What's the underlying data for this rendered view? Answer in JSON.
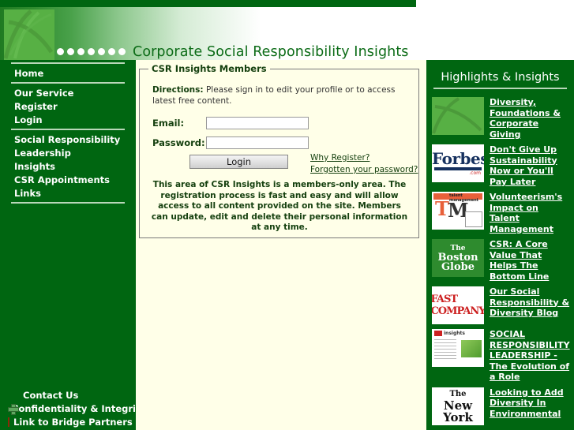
{
  "header": {
    "title": "Corporate Social Responsibility Insights",
    "dot_count": 7,
    "logo_name": "csr-insights-logo"
  },
  "colors": {
    "brand_green": "#006611",
    "header_green": "#0b6b16",
    "content_bg": "#ffffe8",
    "nav_text": "#ffffff",
    "link_green": "#15400f"
  },
  "sidebar": {
    "groups": [
      {
        "items": [
          {
            "label": "Home",
            "name": "sidebar-item-home"
          }
        ]
      },
      {
        "items": [
          {
            "label": "Our Service",
            "name": "sidebar-item-our-service"
          },
          {
            "label": "Register",
            "name": "sidebar-item-register"
          },
          {
            "label": "Login",
            "name": "sidebar-item-login"
          }
        ]
      },
      {
        "items": [
          {
            "label": "Social Responsibility",
            "name": "sidebar-item-social-responsibility"
          },
          {
            "label": "Leadership",
            "name": "sidebar-item-leadership"
          },
          {
            "label": "Insights",
            "name": "sidebar-item-insights"
          },
          {
            "label": "CSR Appointments",
            "name": "sidebar-item-csr-appointments"
          },
          {
            "label": "Links",
            "name": "sidebar-item-links"
          }
        ]
      }
    ],
    "footer_items": [
      {
        "label": "Contact Us",
        "icon": "none"
      },
      {
        "label": "Confidentiality & Integrity",
        "icon": "green-cross-icon"
      },
      {
        "label": "Link to Bridge Partners LLC",
        "icon": "orange-square-icon"
      }
    ]
  },
  "login_panel": {
    "legend": "CSR Insights Members",
    "directions_label": "Directions:",
    "directions_text": " Please sign in to edit your profile or to access latest free content.",
    "email_label": "Email:",
    "email_value": "",
    "email_placeholder": "",
    "password_label": "Password:",
    "password_value": "",
    "password_placeholder": "",
    "help_icon": "?",
    "login_button": "Login",
    "why_register_link": "Why Register?",
    "forgotten_password_link": "Forgotten your password?",
    "notice": "This area of CSR Insights is a members-only area. The registration process is fast and easy and will allow access to all content provided on the site. Members can update, edit and delete their personal information at any time."
  },
  "highlights": {
    "title": "Highlights & Insights",
    "items": [
      {
        "thumb": "csr-insights-logo-thumbnail",
        "text": "Diversity, Foundations & Corporate Giving"
      },
      {
        "thumb": "forbes-logo-thumbnail",
        "text": "Don't Give Up Sustainability Now or You'll Pay Later"
      },
      {
        "thumb": "talent-management-logo-thumbnail",
        "text": "Volunteerism's Impact on Talent Management"
      },
      {
        "thumb": "boston-globe-logo-thumbnail",
        "text": "CSR: A Core Value That Helps The Bottom Line"
      },
      {
        "thumb": "fast-company-logo-thumbnail",
        "text": "Our Social Responsibility & Diversity Blog"
      },
      {
        "thumb": "insights-document-thumbnail",
        "text": "SOCIAL RESPONSIBILITY LEADERSHIP - The Evolution of a Role"
      },
      {
        "thumb": "new-york-times-logo-thumbnail",
        "text": "Looking to Add Diversity In Environmental"
      }
    ],
    "thumb_text": {
      "forbes_word": "Forbes",
      "forbes_com": ".com",
      "tm_tag": "talent management",
      "tm_t": "T",
      "tm_m": "M",
      "globe_the": "The",
      "globe_boston": "Boston",
      "globe_globe": "Globe",
      "fast_company": "FAST COMPANY",
      "doc_title": "insights",
      "nyt_the": "The",
      "nyt_ny": "New York"
    }
  }
}
